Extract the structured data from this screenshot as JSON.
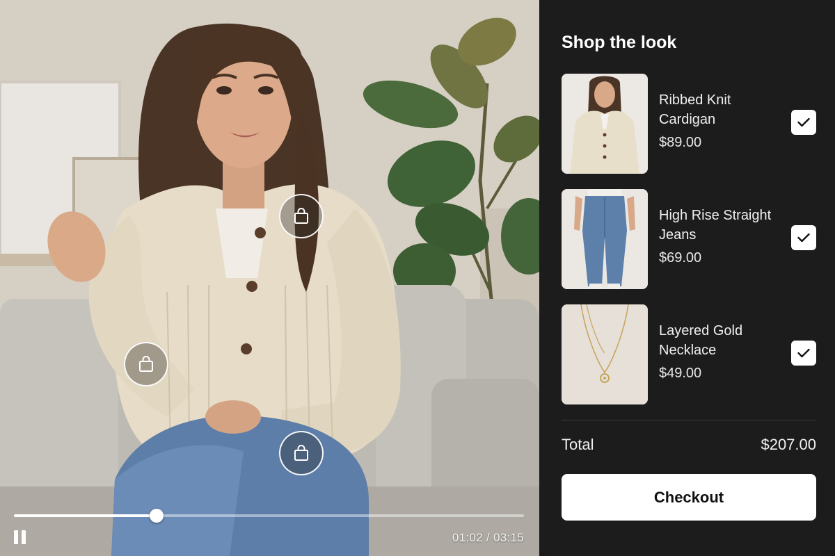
{
  "video": {
    "time_display": "01:02 / 03:15",
    "progress": 0.28,
    "state": "playing",
    "hotspots": [
      {
        "name": "hotspot-cardigan",
        "icon": "shopping-bag-icon"
      },
      {
        "name": "hotspot-necklace",
        "icon": "shopping-bag-icon"
      },
      {
        "name": "hotspot-jeans",
        "icon": "shopping-bag-icon"
      }
    ]
  },
  "panel": {
    "title": "Shop the look",
    "products": [
      {
        "name": "Ribbed Knit Cardigan",
        "price": "$89.00",
        "checked": true
      },
      {
        "name": "High Rise Straight Jeans",
        "price": "$69.00",
        "checked": true
      },
      {
        "name": "Layered Gold Necklace",
        "price": "$49.00",
        "checked": true
      }
    ],
    "total_label": "Total",
    "total_value": "$207.00",
    "checkout_label": "Checkout"
  },
  "colors": {
    "panel_bg": "#1c1c1c",
    "button_bg": "#ffffff",
    "text": "#ffffff"
  }
}
